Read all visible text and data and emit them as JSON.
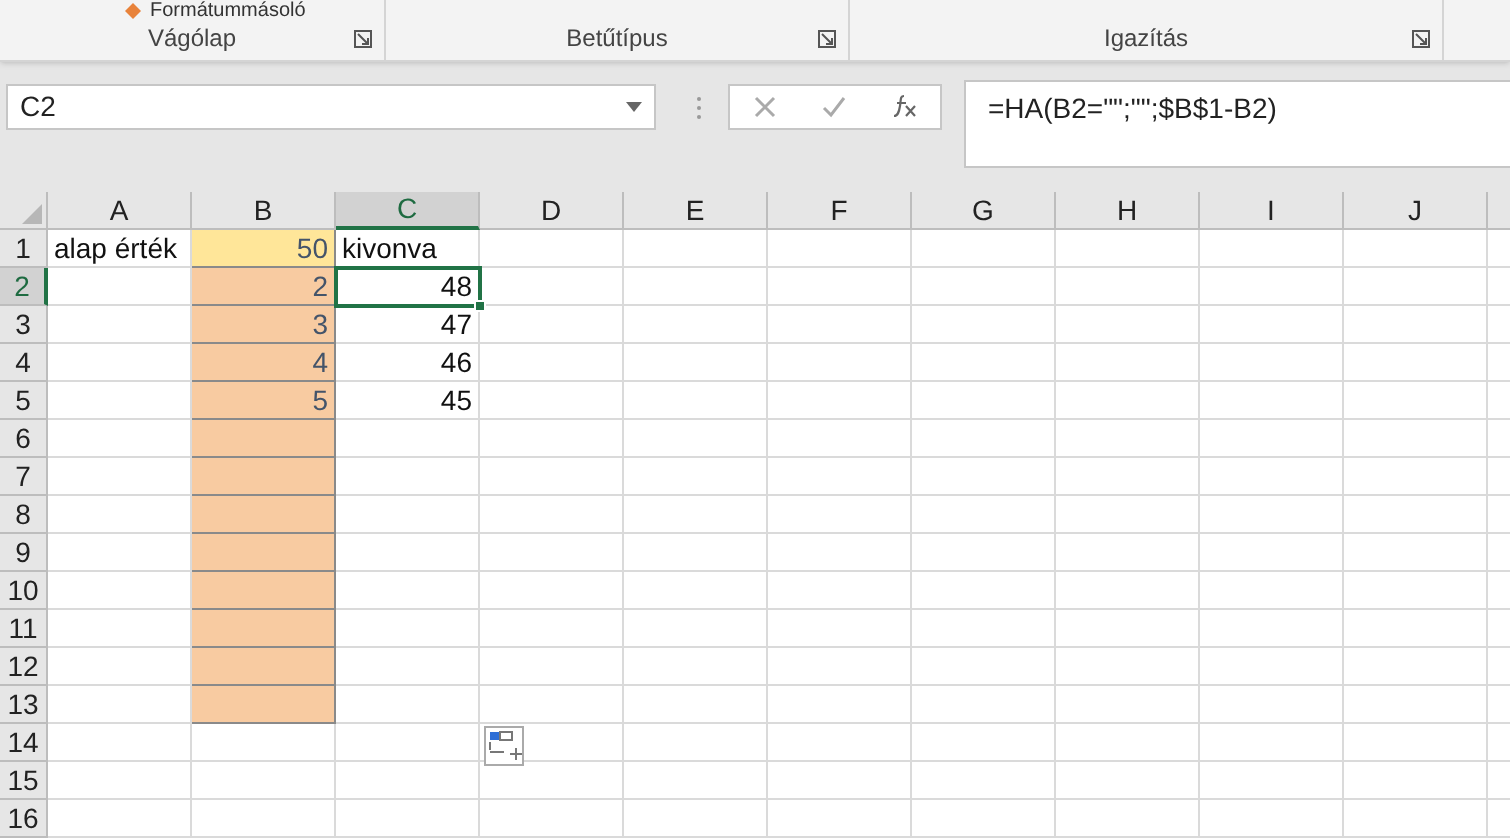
{
  "ribbon": {
    "partial_command": "Formátummásoló",
    "groups": [
      {
        "label": "Vágólap"
      },
      {
        "label": "Betűtípus"
      },
      {
        "label": "Igazítás"
      }
    ]
  },
  "formula_bar": {
    "name_box": "C2",
    "formula": "=HA(B2=\"\";\"\";$B$1-B2)"
  },
  "columns": [
    {
      "label": "A",
      "selected": false
    },
    {
      "label": "B",
      "selected": false
    },
    {
      "label": "C",
      "selected": true
    },
    {
      "label": "D",
      "selected": false
    },
    {
      "label": "E",
      "selected": false
    },
    {
      "label": "F",
      "selected": false
    },
    {
      "label": "G",
      "selected": false
    },
    {
      "label": "H",
      "selected": false
    },
    {
      "label": "I",
      "selected": false
    },
    {
      "label": "J",
      "selected": false
    }
  ],
  "rows": [
    {
      "label": "1",
      "selected": false,
      "cells": [
        {
          "text": "alap érték",
          "kind": "text"
        },
        {
          "text": "50",
          "kind": "number",
          "color": "#ffe699"
        },
        {
          "text": "kivonva",
          "kind": "text"
        }
      ]
    },
    {
      "label": "2",
      "selected": true,
      "cells": [
        {},
        {
          "text": "2",
          "kind": "number",
          "color": "#f8cba1"
        },
        {
          "text": "48",
          "kind": "number",
          "active": true
        }
      ]
    },
    {
      "label": "3",
      "selected": false,
      "cells": [
        {},
        {
          "text": "3",
          "kind": "number",
          "color": "#f8cba1"
        },
        {
          "text": "47",
          "kind": "number"
        }
      ]
    },
    {
      "label": "4",
      "selected": false,
      "cells": [
        {},
        {
          "text": "4",
          "kind": "number",
          "color": "#f8cba1"
        },
        {
          "text": "46",
          "kind": "number"
        }
      ]
    },
    {
      "label": "5",
      "selected": false,
      "cells": [
        {},
        {
          "text": "5",
          "kind": "number",
          "color": "#f8cba1"
        },
        {
          "text": "45",
          "kind": "number"
        }
      ]
    },
    {
      "label": "6",
      "selected": false,
      "cells": [
        {},
        {
          "color": "#f8cba1"
        }
      ]
    },
    {
      "label": "7",
      "selected": false,
      "cells": [
        {},
        {
          "color": "#f8cba1"
        }
      ]
    },
    {
      "label": "8",
      "selected": false,
      "cells": [
        {},
        {
          "color": "#f8cba1"
        }
      ]
    },
    {
      "label": "9",
      "selected": false,
      "cells": [
        {},
        {
          "color": "#f8cba1"
        }
      ]
    },
    {
      "label": "10",
      "selected": false,
      "cells": [
        {},
        {
          "color": "#f8cba1"
        }
      ]
    },
    {
      "label": "11",
      "selected": false,
      "cells": [
        {},
        {
          "color": "#f8cba1"
        }
      ]
    },
    {
      "label": "12",
      "selected": false,
      "cells": [
        {},
        {
          "color": "#f8cba1"
        }
      ]
    },
    {
      "label": "13",
      "selected": false,
      "cells": [
        {},
        {
          "color": "#f8cba1"
        }
      ]
    },
    {
      "label": "14",
      "selected": false,
      "cells": []
    },
    {
      "label": "15",
      "selected": false,
      "cells": []
    },
    {
      "label": "16",
      "selected": false,
      "cells": []
    }
  ]
}
